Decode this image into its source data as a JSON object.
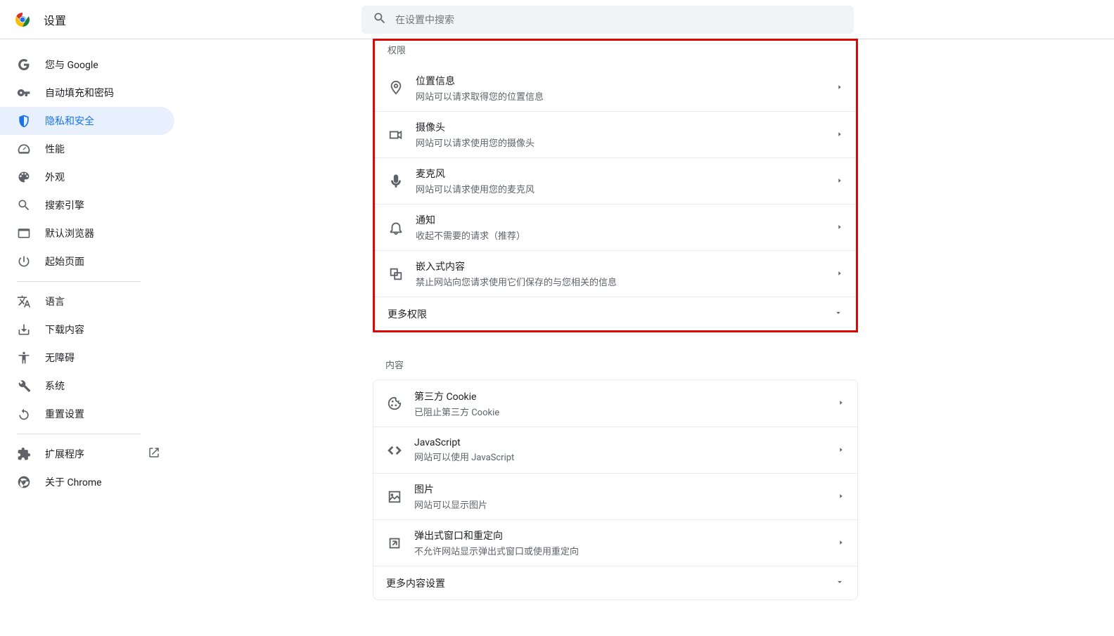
{
  "header": {
    "title": "设置",
    "search_placeholder": "在设置中搜索"
  },
  "sidebar": {
    "items": [
      {
        "label": "您与 Google"
      },
      {
        "label": "自动填充和密码"
      },
      {
        "label": "隐私和安全"
      },
      {
        "label": "性能"
      },
      {
        "label": "外观"
      },
      {
        "label": "搜索引擎"
      },
      {
        "label": "默认浏览器"
      },
      {
        "label": "起始页面"
      }
    ],
    "items2": [
      {
        "label": "语言"
      },
      {
        "label": "下载内容"
      },
      {
        "label": "无障碍"
      },
      {
        "label": "系统"
      },
      {
        "label": "重置设置"
      }
    ],
    "items3": [
      {
        "label": "扩展程序"
      },
      {
        "label": "关于 Chrome"
      }
    ]
  },
  "permissions": {
    "header": "权限",
    "rows": [
      {
        "title": "位置信息",
        "sub": "网站可以请求取得您的位置信息"
      },
      {
        "title": "摄像头",
        "sub": "网站可以请求使用您的摄像头"
      },
      {
        "title": "麦克风",
        "sub": "网站可以请求使用您的麦克风"
      },
      {
        "title": "通知",
        "sub": "收起不需要的请求（推荐）"
      },
      {
        "title": "嵌入式内容",
        "sub": "禁止网站向您请求使用它们保存的与您相关的信息"
      }
    ],
    "more": "更多权限"
  },
  "content": {
    "header": "内容",
    "rows": [
      {
        "title": "第三方 Cookie",
        "sub": "已阻止第三方 Cookie"
      },
      {
        "title": "JavaScript",
        "sub": "网站可以使用 JavaScript"
      },
      {
        "title": "图片",
        "sub": "网站可以显示图片"
      },
      {
        "title": "弹出式窗口和重定向",
        "sub": "不允许网站显示弹出式窗口或使用重定向"
      }
    ],
    "more": "更多内容设置"
  }
}
